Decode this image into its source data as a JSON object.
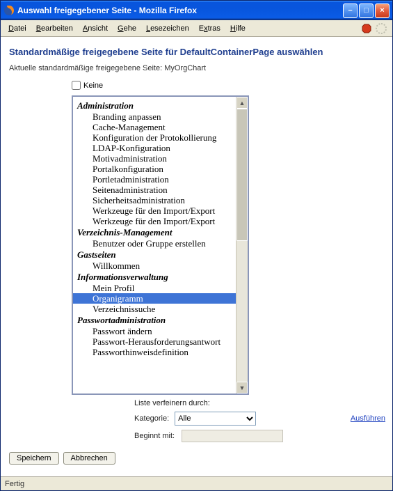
{
  "window": {
    "title": "Auswahl freigegebener Seite - Mozilla Firefox",
    "buttons": {
      "min": "–",
      "max": "□",
      "close": "×"
    }
  },
  "menu": {
    "file": "Datei",
    "edit": "Bearbeiten",
    "view": "Ansicht",
    "go": "Gehe",
    "bookmarks": "Lesezeichen",
    "extras": "Extras",
    "help": "Hilfe"
  },
  "page": {
    "heading": "Standardmäßige freigegebene Seite für DefaultContainerPage auswählen",
    "current": "Aktuelle standardmäßige freigegebene Seite: MyOrgChart",
    "none_label": "Keine"
  },
  "tree": {
    "sections": [
      {
        "title": "Administration",
        "items": [
          "Branding anpassen",
          "Cache-Management",
          "Konfiguration der Protokollierung",
          "LDAP-Konfiguration",
          "Motivadministration",
          "Portalkonfiguration",
          "Portletadministration",
          "Seitenadministration",
          "Sicherheitsadministration",
          "Werkzeuge für den Import/Export",
          "Werkzeuge für den Import/Export"
        ]
      },
      {
        "title": "Verzeichnis-Management",
        "items": [
          "Benutzer oder Gruppe erstellen"
        ]
      },
      {
        "title": "Gastseiten",
        "items": [
          "Willkommen"
        ]
      },
      {
        "title": "Informationsverwaltung",
        "items": [
          "Mein Profil",
          "Organigramm",
          "Verzeichnissuche"
        ]
      },
      {
        "title": "Passwortadministration",
        "items": [
          "Passwort ändern",
          "Passwort-Herausforderungsantwort",
          "Passworthinweisdefinition"
        ]
      }
    ],
    "selected": "Organigramm"
  },
  "refine": {
    "label": "Liste verfeinern durch:",
    "category_label": "Kategorie:",
    "category_value": "Alle",
    "category_options": [
      "Alle"
    ],
    "starts_label": "Beginnt mit:",
    "starts_value": "",
    "execute": "Ausführen"
  },
  "buttons": {
    "save": "Speichern",
    "cancel": "Abbrechen"
  },
  "status": "Fertig"
}
